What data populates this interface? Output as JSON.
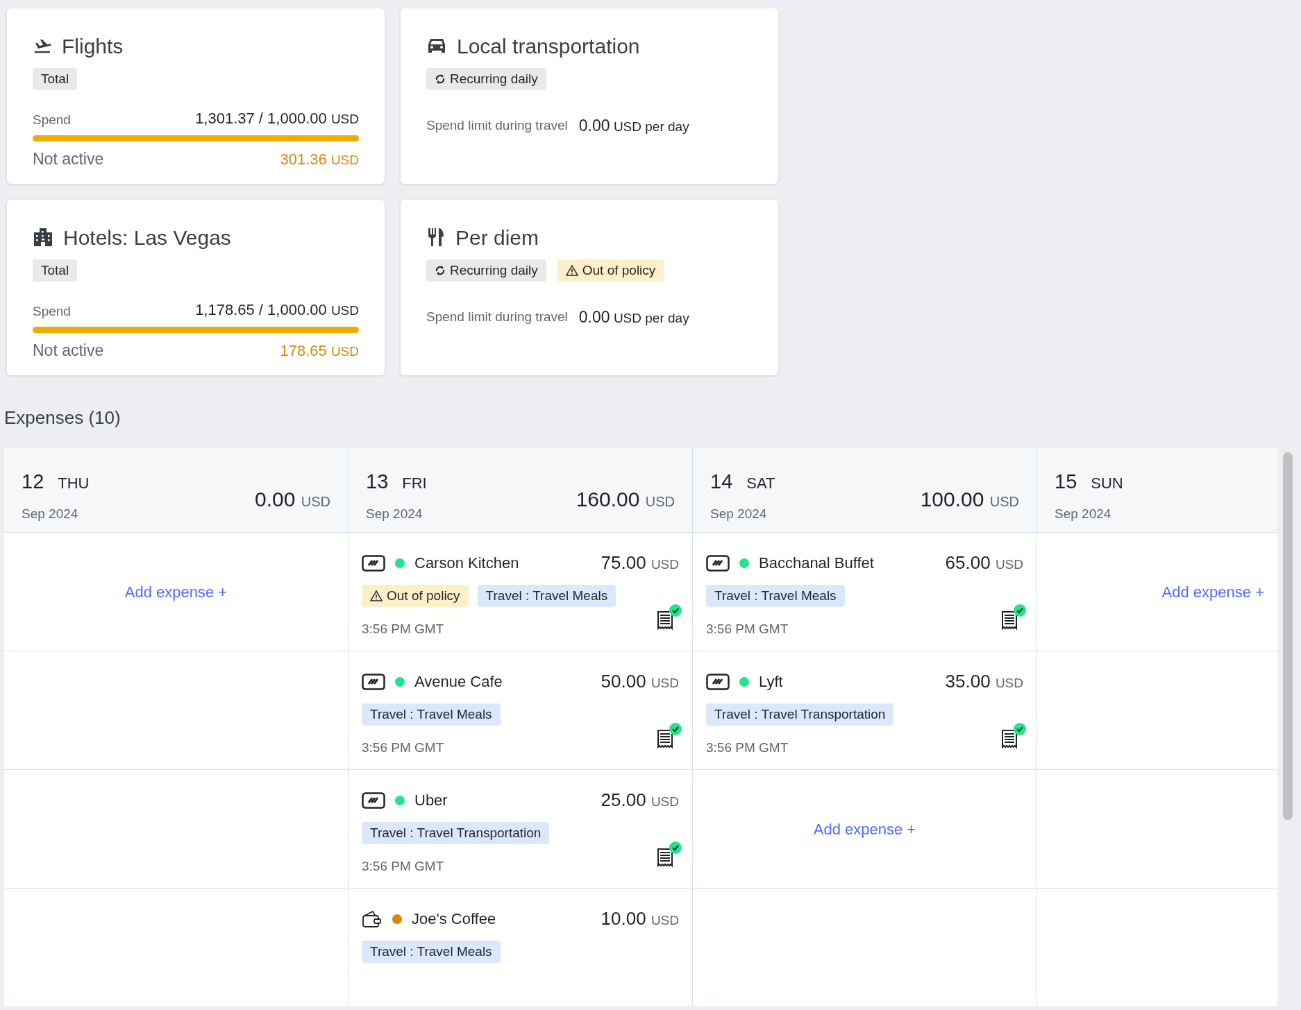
{
  "policy_cards": [
    {
      "title": "Flights",
      "badges": [
        {
          "kind": "plain",
          "label": "Total"
        }
      ],
      "spend": {
        "label": "Spend",
        "amount": "1,301.37 / 1,000.00",
        "currency": "USD",
        "level": 1,
        "status": "Not active",
        "over": "301.36",
        "over_currency": "USD"
      }
    },
    {
      "title": "Local transportation",
      "badges": [
        {
          "kind": "recurring",
          "label": "Recurring daily"
        }
      ],
      "limit": {
        "label": "Spend limit during travel",
        "amount": "0.00",
        "currency": "USD",
        "period": "per day"
      }
    },
    {
      "title": "Hotels: Las Vegas",
      "badges": [
        {
          "kind": "plain",
          "label": "Total"
        }
      ],
      "spend": {
        "label": "Spend",
        "amount": "1,178.65 / 1,000.00",
        "currency": "USD",
        "level": 1,
        "status": "Not active",
        "over": "178.65",
        "over_currency": "USD"
      }
    },
    {
      "title": "Per diem",
      "badges": [
        {
          "kind": "recurring",
          "label": "Recurring daily"
        },
        {
          "kind": "warning",
          "label": "Out of policy"
        }
      ],
      "limit": {
        "label": "Spend limit during travel",
        "amount": "0.00",
        "currency": "USD",
        "period": "per day"
      }
    }
  ],
  "expenses_title": "Expenses (10)",
  "days": [
    {
      "day": "12",
      "weekday": "THU",
      "month": "Sep 2024",
      "total": "0.00",
      "currency": "USD",
      "cells": [
        {
          "kind": "add",
          "label": "Add expense +"
        }
      ]
    },
    {
      "day": "13",
      "weekday": "FRI",
      "month": "Sep 2024",
      "total": "160.00",
      "currency": "USD",
      "cells": [
        {
          "kind": "expense",
          "payment": {
            "kind": "card"
          },
          "color": "#22e58b",
          "merchant": "Carson Kitchen",
          "amount": "75.00",
          "currency": "USD",
          "tags": [
            {
              "kind": "warning",
              "label": "Out of policy"
            },
            {
              "kind": "category",
              "label": "Travel : Travel Meals"
            }
          ],
          "time": "3:56 PM GMT",
          "receipt": true
        },
        {
          "kind": "expense",
          "payment": {
            "kind": "card"
          },
          "color": "#22e58b",
          "merchant": "Avenue Cafe",
          "amount": "50.00",
          "currency": "USD",
          "tags": [
            {
              "kind": "category",
              "label": "Travel : Travel Meals"
            }
          ],
          "time": "3:56 PM GMT",
          "receipt": true
        },
        {
          "kind": "expense",
          "payment": {
            "kind": "card"
          },
          "color": "#22e58b",
          "merchant": "Uber",
          "amount": "25.00",
          "currency": "USD",
          "tags": [
            {
              "kind": "category",
              "label": "Travel : Travel Transportation"
            }
          ],
          "time": "3:56 PM GMT",
          "receipt": true
        },
        {
          "kind": "expense",
          "payment": {
            "kind": "wallet"
          },
          "color": "#d9860b",
          "merchant": "Joe's Coffee",
          "amount": "10.00",
          "currency": "USD",
          "tags": [
            {
              "kind": "category",
              "label": "Travel : Travel Meals"
            }
          ]
        }
      ]
    },
    {
      "day": "14",
      "weekday": "SAT",
      "month": "Sep 2024",
      "total": "100.00",
      "currency": "USD",
      "cells": [
        {
          "kind": "expense",
          "payment": {
            "kind": "card"
          },
          "color": "#22e58b",
          "merchant": "Bacchanal Buffet",
          "amount": "65.00",
          "currency": "USD",
          "tags": [
            {
              "kind": "category",
              "label": "Travel : Travel Meals"
            }
          ],
          "time": "3:56 PM GMT",
          "receipt": true
        },
        {
          "kind": "expense",
          "payment": {
            "kind": "card"
          },
          "color": "#22e58b",
          "merchant": "Lyft",
          "amount": "35.00",
          "currency": "USD",
          "tags": [
            {
              "kind": "category",
              "label": "Travel : Travel Transportation"
            }
          ],
          "time": "3:56 PM GMT",
          "receipt": true
        },
        {
          "kind": "add",
          "label": "Add expense +"
        }
      ]
    },
    {
      "day": "15",
      "weekday": "SUN",
      "month": "Sep 2024",
      "cells": [
        {
          "kind": "add",
          "label": "Add expense +"
        }
      ]
    }
  ]
}
